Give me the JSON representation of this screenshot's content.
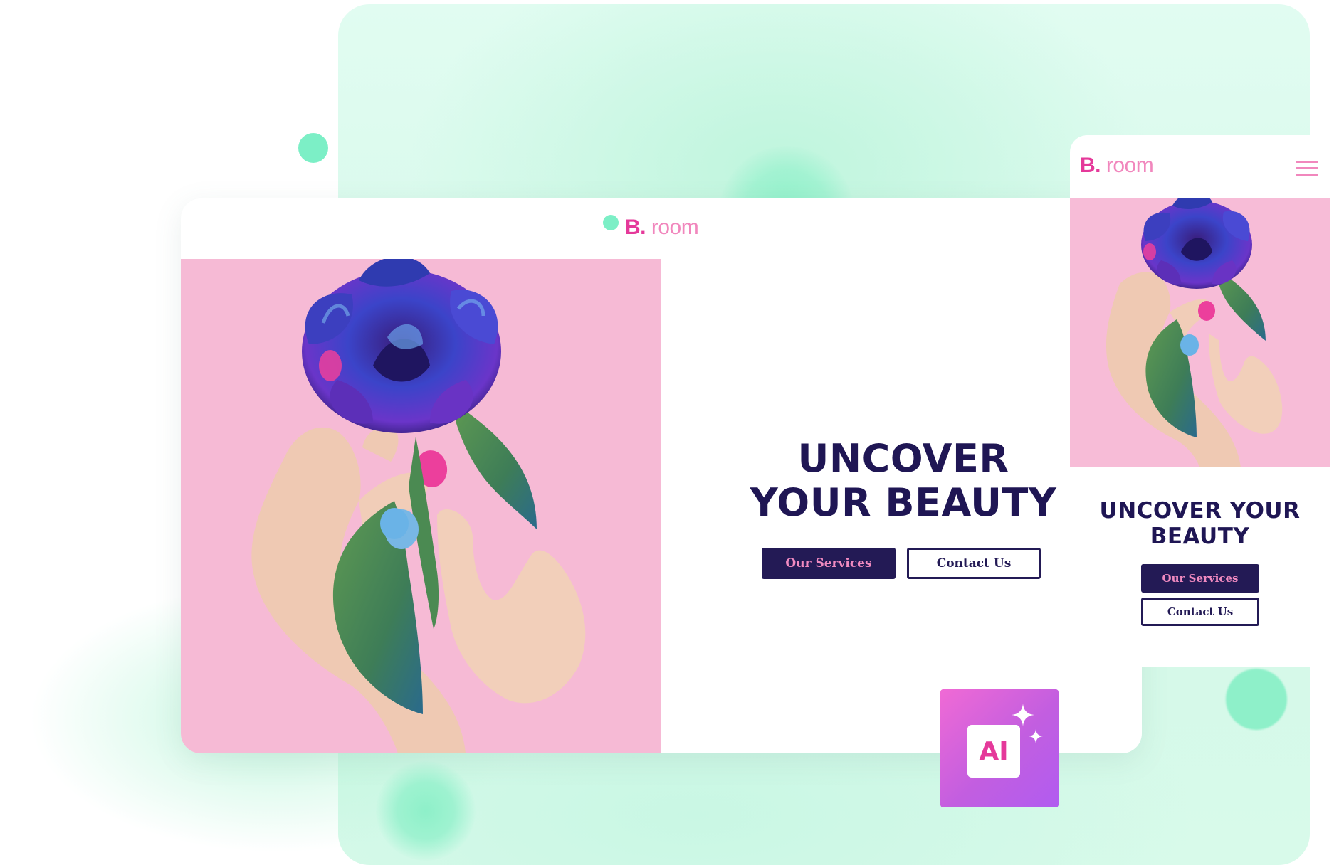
{
  "desktop": {
    "brand": {
      "mark": "B.",
      "name": "room"
    },
    "headline": {
      "line1": "UNCOVER",
      "line2": "YOUR BEAUTY"
    },
    "buttons": {
      "services": "Our Services",
      "contact": "Contact Us"
    }
  },
  "mobile": {
    "brand": {
      "mark": "B.",
      "name": "room"
    },
    "menu_icon": "hamburger-menu-icon",
    "headline": {
      "line1": "UNCOVER YOUR",
      "line2": "BEAUTY"
    },
    "buttons": {
      "services": "Our Services",
      "contact": "Contact Us"
    }
  },
  "ai_badge": {
    "label": "AI",
    "icon": "sparkle-icon"
  },
  "colors": {
    "brand_pink": "#e5399a",
    "brand_pink_light": "#f187bd",
    "navy": "#231a55",
    "mint": "#7cefc6",
    "hero_background": "#f7bcd7",
    "ai_gradient": [
      "#f06ad5",
      "#b15cf0"
    ]
  }
}
